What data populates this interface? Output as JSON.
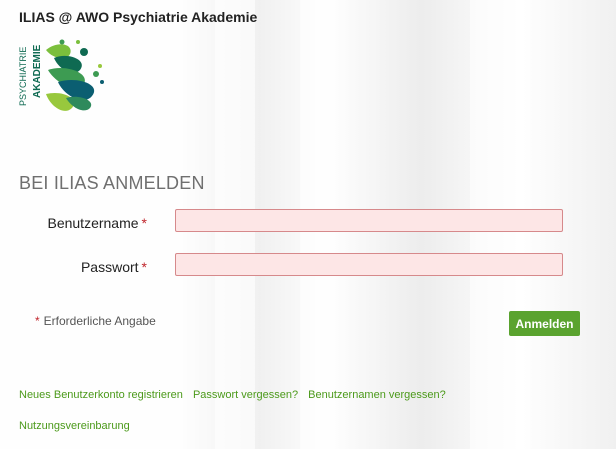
{
  "header": {
    "site_title": "ILIAS @ AWO Psychiatrie Akademie"
  },
  "logo": {
    "line1": "PSYCHIATRIE",
    "line2": "AKADEMIE",
    "colors": [
      "#0f6a52",
      "#3d9b52",
      "#7bbf3c",
      "#0b5e71",
      "#98c83d"
    ]
  },
  "login": {
    "title": "BEI ILIAS ANMELDEN",
    "username_label": "Benutzername",
    "password_label": "Passwort",
    "required_marker": "*",
    "username_value": "",
    "password_value": "",
    "required_note": "Erforderliche Angabe",
    "submit_label": "Anmelden"
  },
  "links": {
    "register": "Neues Benutzerkonto registrieren",
    "forgot_password": "Passwort vergessen?",
    "forgot_username": "Benutzernamen vergessen?",
    "terms": "Nutzungsvereinbarung"
  },
  "colors": {
    "accent": "#5aa32f",
    "link": "#4c9a1b",
    "required": "#c0252c",
    "input_error_bg": "#fde6e6"
  }
}
